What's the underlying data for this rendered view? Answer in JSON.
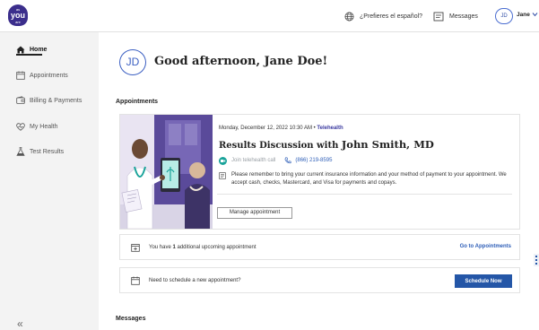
{
  "header": {
    "logo": {
      "line1": "as",
      "line2": "you",
      "line3": "are"
    },
    "language_link": "¿Prefieres el español?",
    "messages_link": "Messages",
    "user_initials": "JD",
    "user_name": "Jane",
    "icons": {
      "language": "globe-icon",
      "messages": "message-icon",
      "menu": "chevron-down-icon"
    }
  },
  "sidebar": {
    "items": [
      {
        "label": "Home",
        "icon": "home-icon",
        "active": true
      },
      {
        "label": "Appointments",
        "icon": "calendar-icon",
        "active": false
      },
      {
        "label": "Billing & Payments",
        "icon": "wallet-icon",
        "active": false
      },
      {
        "label": "My Health",
        "icon": "heart-icon",
        "active": false
      },
      {
        "label": "Test Results",
        "icon": "flask-icon",
        "active": false
      }
    ],
    "collapse_label": "«"
  },
  "main": {
    "avatar_initials": "JD",
    "greeting": "Good afternoon, Jane Doe!",
    "appointments_title": "Appointments",
    "messages_title": "Messages",
    "appointment": {
      "date": "Monday, December 12, 2022 10:30 AM",
      "separator": " • ",
      "type": "Telehealth",
      "title_prefix": "Results Discussion with ",
      "doctor": "John Smith, MD",
      "join_label": "Join telehealth call",
      "phone": "(866) 219-8595",
      "note": "Please remember to bring your current insurance information and your method of payment to your appointment. We accept cash, checks, Mastercard, and Visa for payments and copays.",
      "manage_button": "Manage appointment"
    },
    "upcoming": {
      "text_before": "You have ",
      "count": "1",
      "text_after": " additional upcoming appointment",
      "link": "Go to Appointments"
    },
    "schedule": {
      "text": "Need to schedule a new appointment?",
      "button": "Schedule Now"
    }
  },
  "colors": {
    "brand": "#3b2e8c",
    "accent_blue": "#2456a7",
    "link_blue": "#2f5fb8",
    "telehealth_green": "#1aa39a",
    "sidebar_bg": "#f3f3f3"
  }
}
